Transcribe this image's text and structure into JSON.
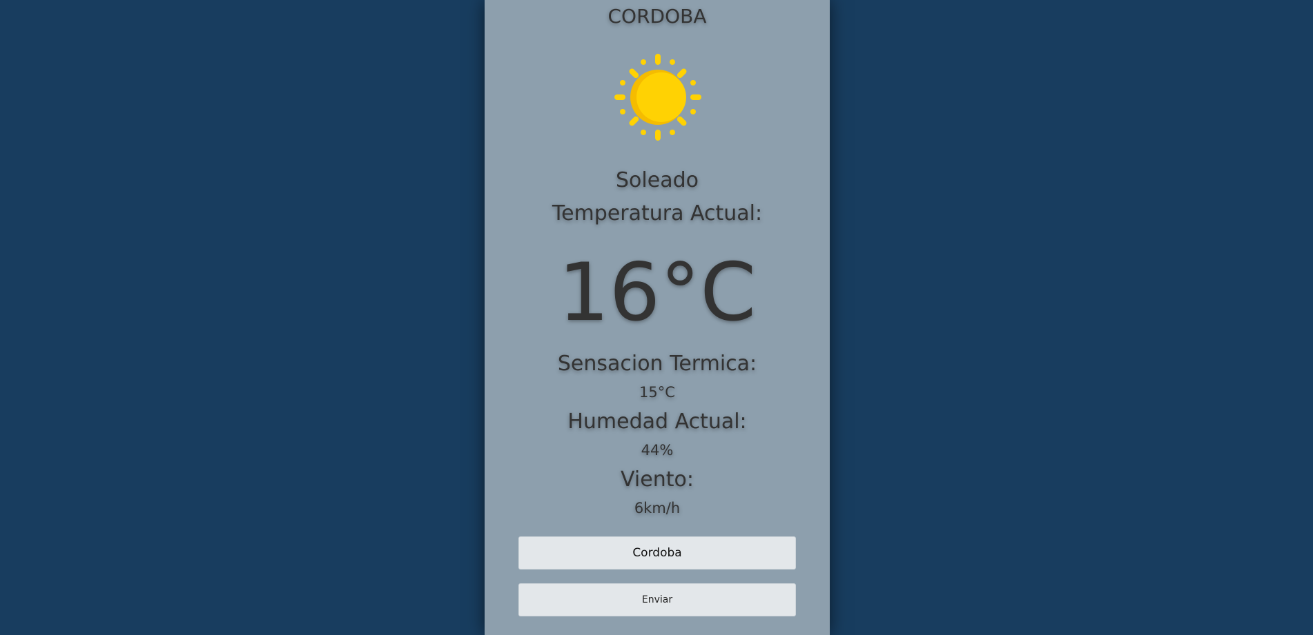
{
  "weather": {
    "city_title": "CORDOBA",
    "condition_icon": "sun-icon",
    "condition": "Soleado",
    "temperature_label": "Temperatura Actual:",
    "temperature_value": "16°C",
    "feels_like_label": "Sensacion Termica:",
    "feels_like_value": "15°C",
    "humidity_label": "Humedad Actual:",
    "humidity_value": "44%",
    "wind_label": "Viento:",
    "wind_value": "6km/h"
  },
  "form": {
    "city_input_value": "Cordoba",
    "send_label": "Enviar"
  },
  "colors": {
    "page_background": "#183d5f",
    "card_background": "#8d9fad",
    "sun_yellow": "#ffd203",
    "sun_shade": "#f5bc00",
    "text": "#333333"
  }
}
